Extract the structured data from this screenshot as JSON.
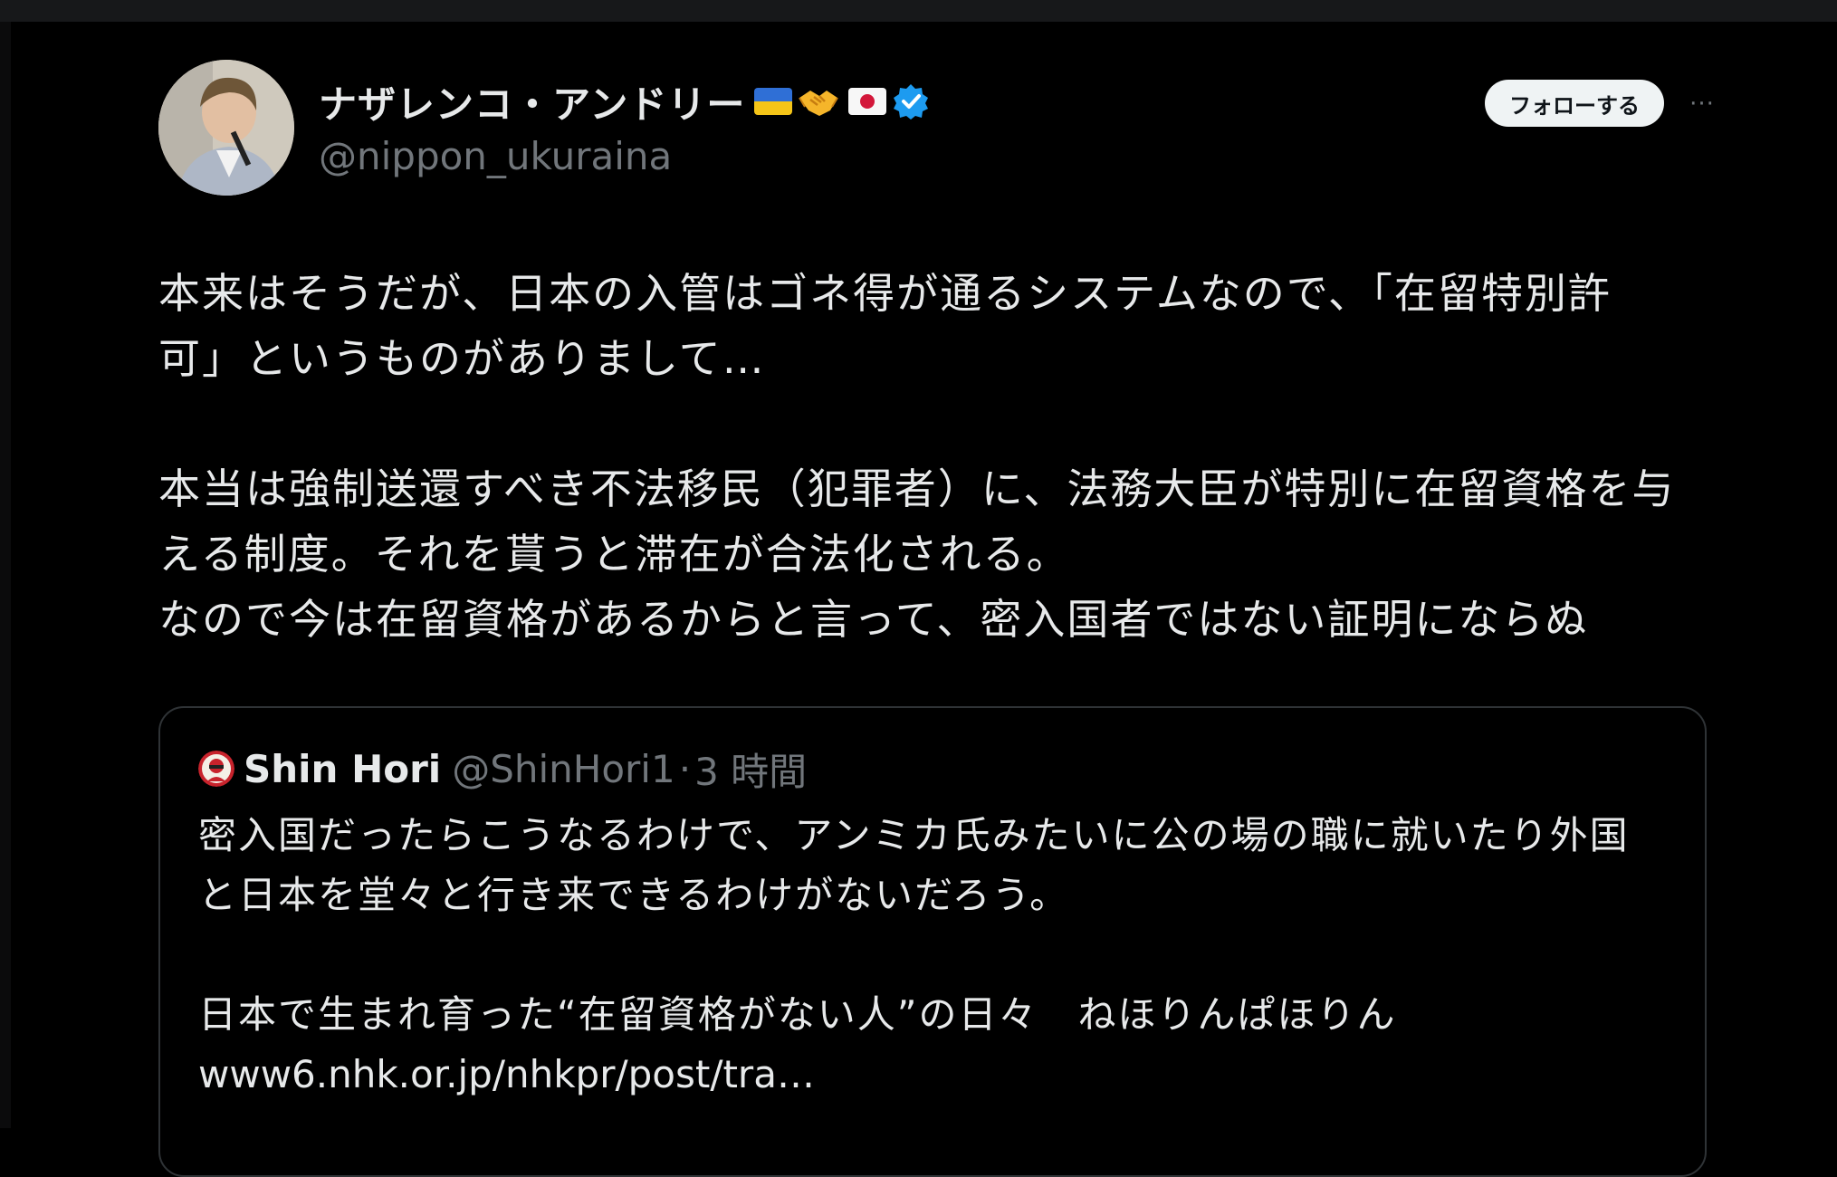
{
  "tweet": {
    "author": {
      "display_name": "ナザレンコ・アンドリー",
      "handle": "@nippon_ukuraina",
      "verified": true,
      "name_emojis": [
        "ukraine-flag",
        "handshake",
        "japan-flag"
      ]
    },
    "follow_label": "フォローする",
    "more_label": "···",
    "text_lines": [
      "本来はそうだが、日本の入管はゴネ得が通るシステムなので、「在留特別許",
      "可」というものがありまして…",
      "",
      "本当は強制送還すべき不法移民（犯罪者）に、法務大臣が特別に在留資格を与",
      "える制度。それを貰うと滞在が合法化される。",
      "なので今は在留資格があるからと言って、密入国者ではない証明にならぬ"
    ]
  },
  "quote": {
    "display_name": "Shin Hori",
    "handle": "@ShinHori1",
    "separator": "·",
    "time": "3 時間",
    "text_lines": [
      "密入国だったらこうなるわけで、アンミカ氏みたいに公の場の職に就いたり外国",
      "と日本を堂々と行き来できるわけがないだろう。",
      "",
      "日本で生まれ育った“在留資格がない人”の日々　ねほりんぱほりん"
    ],
    "link": "www6.nhk.or.jp/nhkpr/post/tra…"
  },
  "colors": {
    "background": "#000000",
    "primary_text": "#e7e9ea",
    "secondary_text": "#71767b",
    "border": "#2f3336",
    "verified_blue": "#1d9bf0",
    "follow_bg": "#eff3f4"
  }
}
